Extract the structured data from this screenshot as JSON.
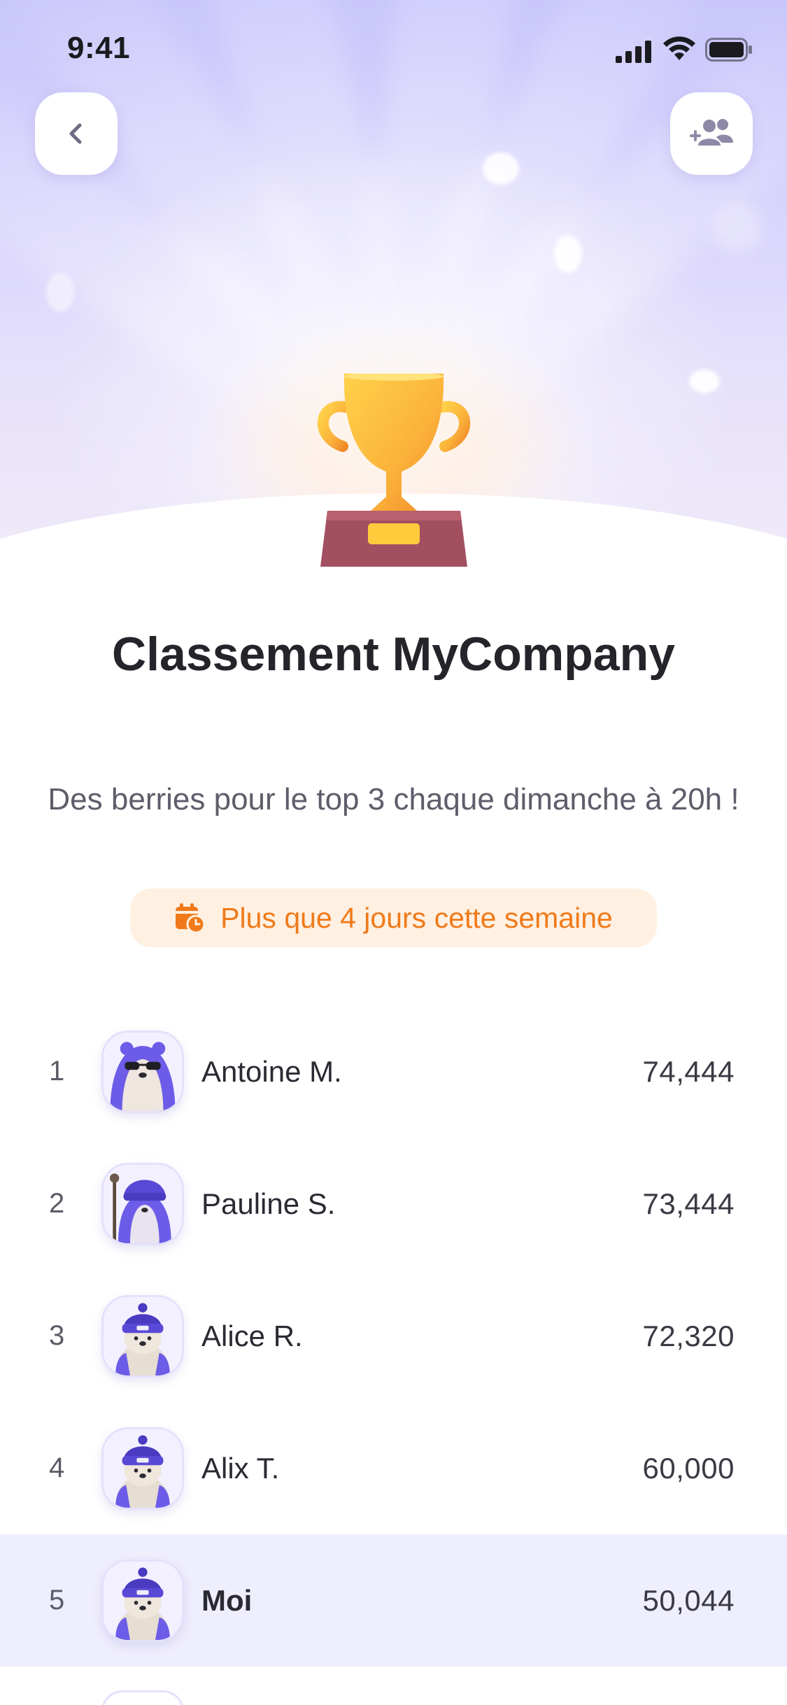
{
  "status_bar": {
    "time": "9:41"
  },
  "header": {
    "back_icon": "chevron-left-icon",
    "friends_icon": "add-friends-icon"
  },
  "hero": {
    "trophy_icon": "trophy-icon"
  },
  "title": "Classement MyCompany",
  "subtitle": "Des berries pour le top 3 chaque dimanche à 20h !",
  "badge": {
    "icon": "calendar-clock-icon",
    "text": "Plus que 4 jours cette semaine",
    "color": "#f07a1a",
    "background": "#fff0e2"
  },
  "leaderboard": [
    {
      "rank": "1",
      "name": "Antoine M.",
      "score": "74,444",
      "avatar": "bear-sunglasses-avatar"
    },
    {
      "rank": "2",
      "name": "Pauline S.",
      "score": "73,444",
      "avatar": "bear-wizard-avatar"
    },
    {
      "rank": "3",
      "name": "Alice R.",
      "score": "72,320",
      "avatar": "bear-beanie-avatar"
    },
    {
      "rank": "4",
      "name": "Alix T.",
      "score": "60,000",
      "avatar": "bear-beanie-avatar"
    },
    {
      "rank": "5",
      "name": "Moi",
      "score": "50,044",
      "avatar": "bear-beanie-avatar",
      "is_current_user": true
    }
  ],
  "colors": {
    "hero_top": "#c9c6fb",
    "accent": "#6a5ae0",
    "current_user_row": "#efeefd"
  }
}
